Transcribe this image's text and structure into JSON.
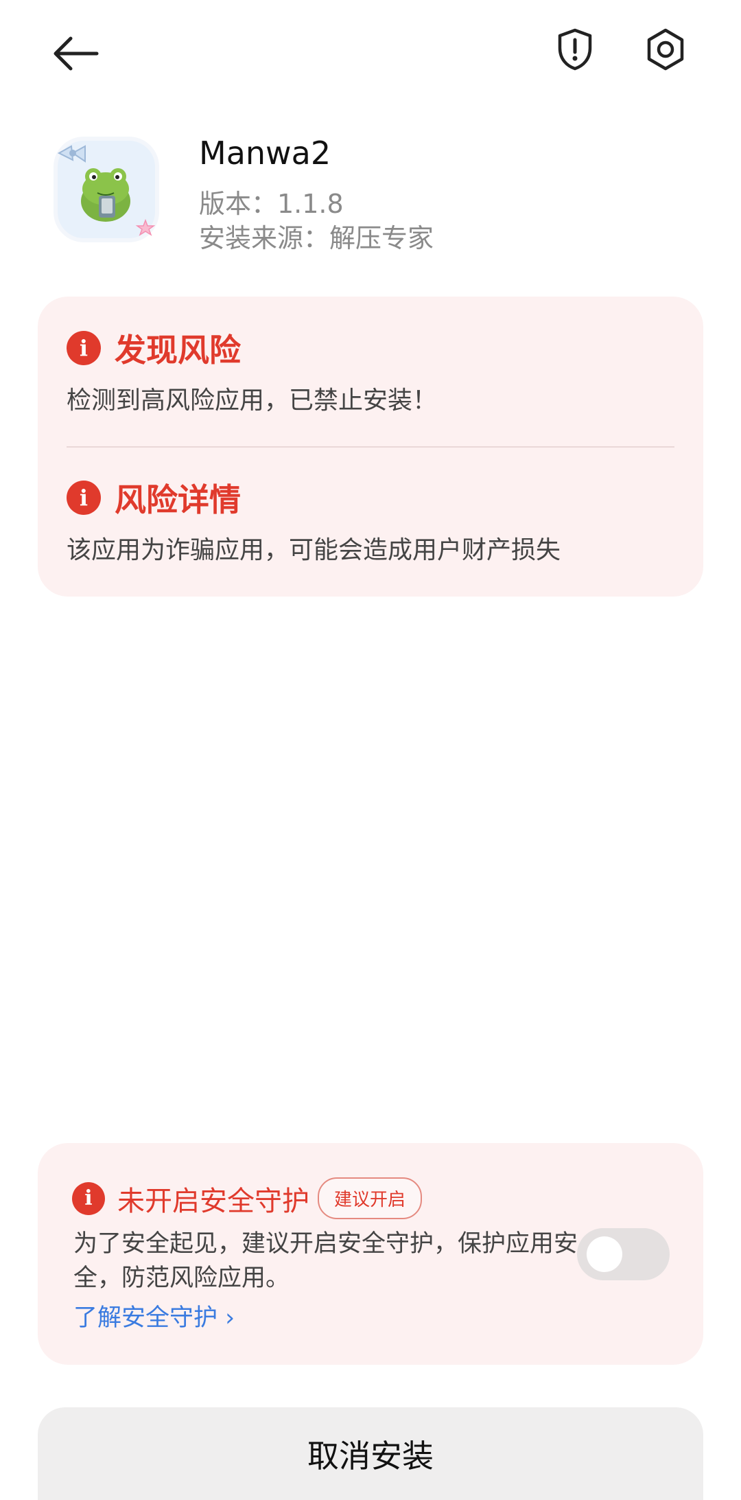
{
  "app": {
    "name": "Manwa2",
    "version": "版本：1.1.8",
    "source": "安装来源：解压专家"
  },
  "risk": {
    "found_title": "发现风险",
    "found_desc": "检测到高风险应用，已禁止安装！",
    "detail_title": "风险详情",
    "detail_desc": "该应用为诈骗应用，可能会造成用户财产损失"
  },
  "protection": {
    "title": "未开启安全守护",
    "badge": "建议开启",
    "desc": "为了安全起见，建议开启安全守护，保护应用安全，防范风险应用。",
    "link": "了解安全守护 ›",
    "enabled": false
  },
  "actions": {
    "cancel": "取消安装"
  },
  "colors": {
    "danger": "#e03a2c",
    "card_bg": "#fdf1f1",
    "link": "#3a7be0"
  },
  "icons": {
    "back": "arrow-left-icon",
    "shield": "shield-alert-icon",
    "settings": "gear-icon",
    "info": "info-icon"
  }
}
